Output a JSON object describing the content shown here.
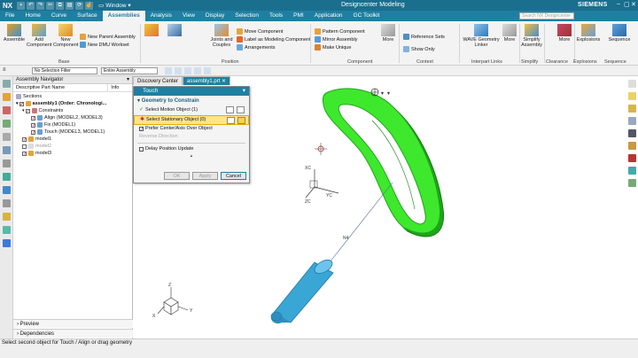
{
  "titlebar": {
    "logo": "NX",
    "window_menu": "Window",
    "title": "Designcenter Modeling",
    "brand": "SIEMENS"
  },
  "menubar": {
    "tabs": [
      "File",
      "Home",
      "Curve",
      "Surface",
      "Assemblies",
      "Analysis",
      "View",
      "Display",
      "Selection",
      "Tools",
      "PMI",
      "Application",
      "GC Toolkit"
    ],
    "active": "Assemblies",
    "search_placeholder": "Search NX Designcenter"
  },
  "ribbon": {
    "assemble": "Assemble",
    "add_component": "Add Component",
    "new_component": "New Component",
    "new_parent": "New Parent Assembly",
    "new_dmu": "New DMU Workset",
    "base_label": "Base",
    "move_component": "Move Component",
    "joints_couples": "Joints and Couples",
    "assembly_constraints": "Assembly Constraints",
    "label_modeling": "Label as Modeling Component",
    "arrangements": "Arrangements",
    "position_label": "Position",
    "pattern_component": "Pattern Component",
    "mirror_assembly": "Mirror Assembly",
    "make_unique": "Make Unique",
    "more1": "More",
    "component_label": "Component",
    "reference_sets": "Reference Sets",
    "show_only": "Show Only",
    "context_label": "Context",
    "wave_linker": "WAVE Geometry Linker",
    "interpart_label": "Interpart Links",
    "more2": "More",
    "simplify_assembly": "Simplify Assembly",
    "simplify_label": "Simplify",
    "more3": "More",
    "clearance_label": "Clearance",
    "explosions": "Explosions",
    "explosions_label": "Explosions",
    "sequence": "Sequence",
    "sequence_label": "Sequence"
  },
  "filterbar": {
    "selection_filter": "No Selection Filter",
    "scope": "Entire Assembly"
  },
  "navigator": {
    "title": "Assembly Navigator",
    "col_name": "Descriptive Part Name",
    "col_info": "Info",
    "rows": [
      {
        "label": "Sections",
        "dim": false
      },
      {
        "label": "assembly1 (Order: Chronologi...",
        "dim": false
      },
      {
        "label": "Constraints",
        "dim": false
      },
      {
        "label": "Align (MODEL2, MODEL3)",
        "dim": false
      },
      {
        "label": "Fix (MODEL1)",
        "dim": false
      },
      {
        "label": "Touch (MODEL3, MODEL1)",
        "dim": false
      },
      {
        "label": "model1",
        "dim": false
      },
      {
        "label": "model2",
        "dim": true
      },
      {
        "label": "model3",
        "dim": false
      }
    ],
    "preview": "Preview",
    "dependencies": "Dependencies"
  },
  "doctabs": [
    "Discovery Center",
    "assembly1.prt"
  ],
  "dialog": {
    "title": "Touch",
    "section": "Geometry to Constrain",
    "motion": "Select Motion Object (1)",
    "stationary": "Select Stationary Object (0)",
    "prefer_center": "Prefer Center/Axis Over Object",
    "reverse": "Reverse Direction",
    "delay": "Delay Position Update",
    "ok": "OK",
    "apply": "Apply",
    "cancel": "Cancel"
  },
  "graphics": {
    "axis_x": "X",
    "axis_y": "Y",
    "axis_z": "Z",
    "axis_xc": "XC",
    "axis_yc": "YC",
    "axis_zc": "ZC",
    "n4_label": "N4"
  },
  "status": {
    "text": "Select second object for Touch / Align or drag geometry"
  },
  "colors": {
    "accent": "#1f7fa2",
    "green_part": "#2ecc1f",
    "blue_part": "#3aa6d6"
  }
}
